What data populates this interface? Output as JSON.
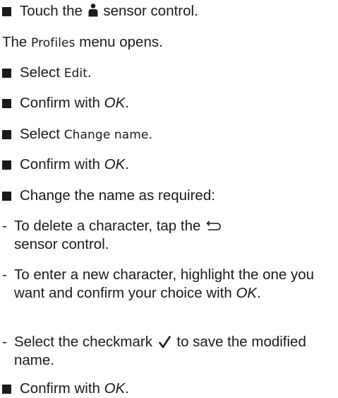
{
  "steps": {
    "touch": {
      "before": "Touch the",
      "icon": "person-icon",
      "after": "sensor control."
    },
    "profiles_opens": {
      "before": "The",
      "menu": "Profiles",
      "after": "menu opens."
    },
    "select_edit": {
      "before": "Select",
      "menu": "Edit",
      "after": "."
    },
    "confirm1": {
      "before": "Confirm with",
      "ok": "OK",
      "after": "."
    },
    "select_change": {
      "before": "Select",
      "menu": "Change name",
      "after": "."
    },
    "confirm2": {
      "before": "Confirm with",
      "ok": "OK",
      "after": "."
    },
    "change_name": {
      "text": "Change the name as required:"
    },
    "sub1": {
      "dash": "-",
      "before": "To delete a character, tap the",
      "icon": "back-arrow-icon",
      "after": "sensor control."
    },
    "sub2": {
      "dash": "-",
      "before": "To enter a new character, highlight the one you want and confirm your choice with",
      "ok": "OK",
      "after": "."
    },
    "sub3": {
      "dash": "-",
      "before": "Select the checkmark",
      "icon": "checkmark-icon",
      "after": "to save the modified name."
    },
    "confirm3": {
      "before": "Confirm with",
      "ok": "OK",
      "after": "."
    }
  },
  "colors": {
    "text": "#1a1a1a",
    "background": "#ffffff"
  }
}
